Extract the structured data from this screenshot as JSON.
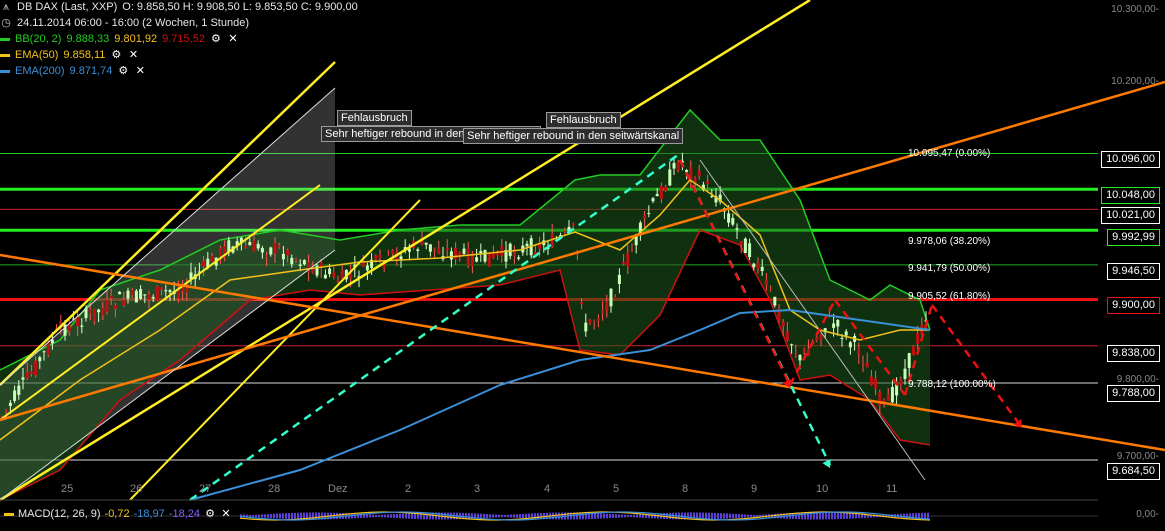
{
  "header": {
    "instrument": "DB DAX (Last, XXP)",
    "ohlc": "O: 9.858,50   H: 9.908,50   L: 9.853,50   C: 9.900,00",
    "period": "24.11.2014 06:00 - 16:00 (2 Wochen, 1 Stunde)",
    "bb_label": "BB(20, 2)",
    "bb_v1": "9.888,33",
    "bb_v2": "9.801,92",
    "bb_v3": "9.715,52",
    "ema50_label": "EMA(50)",
    "ema50_value": "9.858,11",
    "ema200_label": "EMA(200)",
    "ema200_value": "9.871,74"
  },
  "colors": {
    "bb": "#22cc22",
    "bb_lower": "#cc1111",
    "ema50": "#f2c21b",
    "ema200": "#3a8fd8",
    "resistance": "#22ee22",
    "support_red": "#ee1111",
    "orange": "#ff7a00",
    "yellow": "#ffee22",
    "cyan": "#33ffcc"
  },
  "annotations": {
    "note1_title": "Fehlausbruch",
    "note1_text": "Sehr heftiger rebound in den seitwärtskanal",
    "note2_title": "Fehlausbruch",
    "note2_text": "Sehr heftiger rebound in den seitwärtskanal"
  },
  "fib": {
    "f0": "10.095,47 (0.00%)",
    "f382": "9.978,06 (38.20%)",
    "f50": "9.941,79 (50.00%)",
    "f618": "9.905,52 (61.80%)",
    "f100": "9.788,12 (100.00%)"
  },
  "price_labels": {
    "p1": "10.096,00",
    "p2": "10.048,00",
    "p3": "10.021,00",
    "p4": "9.992,99",
    "p5": "9.946,50",
    "p6": "9.900,00",
    "p7": "9.838,00",
    "p8": "9.788,00",
    "p9": "9.684,50"
  },
  "y_ticks": {
    "t1": "10.300,00-",
    "t2": "10.200,00-",
    "t3": "9.800,00-",
    "t4": "9.700,00-",
    "macd_zero": "0,00-"
  },
  "macd": {
    "label": "MACD(12, 26, 9)",
    "v1": "-0,72",
    "v2": "-18,97",
    "v3": "-18,24"
  },
  "chart_data": {
    "type": "line",
    "title": "DB DAX (Last, XXP)",
    "x_ticks": [
      "25",
      "26",
      "27",
      "28",
      "Dez",
      "2",
      "3",
      "4",
      "5",
      "8",
      "9",
      "10",
      "11"
    ],
    "ylim": [
      9650,
      10310
    ],
    "price_path": [
      {
        "x": "24.11",
        "y": 9735
      },
      {
        "x": "25",
        "y": 9880
      },
      {
        "x": "26",
        "y": 9935
      },
      {
        "x": "27",
        "y": 9990
      },
      {
        "x": "28",
        "y": 9965
      },
      {
        "x": "Dez",
        "y": 9950
      },
      {
        "x": "2",
        "y": 9960
      },
      {
        "x": "3",
        "y": 9975
      },
      {
        "x": "4",
        "y": 10010
      },
      {
        "x": "4b",
        "y": 9880
      },
      {
        "x": "5",
        "y": 9940
      },
      {
        "x": "5b",
        "y": 10095
      },
      {
        "x": "8",
        "y": 10060
      },
      {
        "x": "9",
        "y": 9930
      },
      {
        "x": "9b",
        "y": 9800
      },
      {
        "x": "10",
        "y": 9880
      },
      {
        "x": "10b",
        "y": 9850
      },
      {
        "x": "11",
        "y": 9770
      },
      {
        "x": "11b",
        "y": 9900
      }
    ],
    "ema200_path": [
      {
        "x": "26",
        "y": 9560
      },
      {
        "x": "Dez",
        "y": 9700
      },
      {
        "x": "3",
        "y": 9780
      },
      {
        "x": "5",
        "y": 9840
      },
      {
        "x": "8",
        "y": 9880
      },
      {
        "x": "9",
        "y": 9900
      },
      {
        "x": "10",
        "y": 9885
      },
      {
        "x": "11b",
        "y": 9871.74
      }
    ],
    "fib_levels": [
      {
        "pct": 0.0,
        "value": 10095.47
      },
      {
        "pct": 38.2,
        "value": 9978.06
      },
      {
        "pct": 50.0,
        "value": 9941.79
      },
      {
        "pct": 61.8,
        "value": 9905.52
      },
      {
        "pct": 100.0,
        "value": 9788.12
      }
    ],
    "horizontal_levels": [
      10096.0,
      10048.0,
      10021.0,
      9992.99,
      9946.5,
      9900.0,
      9838.0,
      9788.0,
      9684.5
    ]
  }
}
